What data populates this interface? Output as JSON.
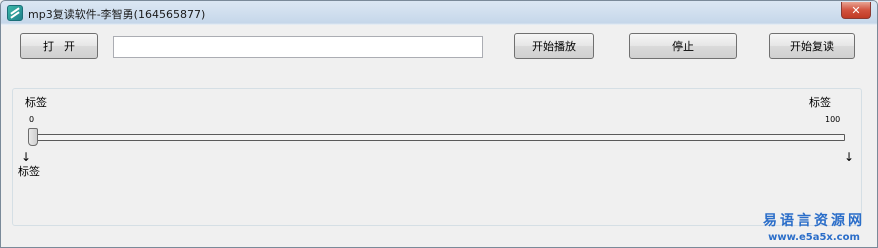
{
  "window": {
    "title": "mp3复读软件-李智勇(164565877)"
  },
  "toolbar": {
    "open_label": "打开",
    "file_path_value": "",
    "play_label": "开始播放",
    "stop_label": "停止",
    "repeat_label": "开始复读"
  },
  "slider_panel": {
    "label_top_left": "标签",
    "label_top_right": "标签",
    "min_value": "0",
    "max_value": "100",
    "label_bottom_left": "标签",
    "position": 0,
    "marker_left": "↓",
    "marker_right": "↓"
  },
  "watermark": {
    "title": "易语言资源网",
    "url": "www.e5a5x.com"
  },
  "colors": {
    "watermark": "#2b6ec9",
    "close_button": "#c03a25"
  }
}
